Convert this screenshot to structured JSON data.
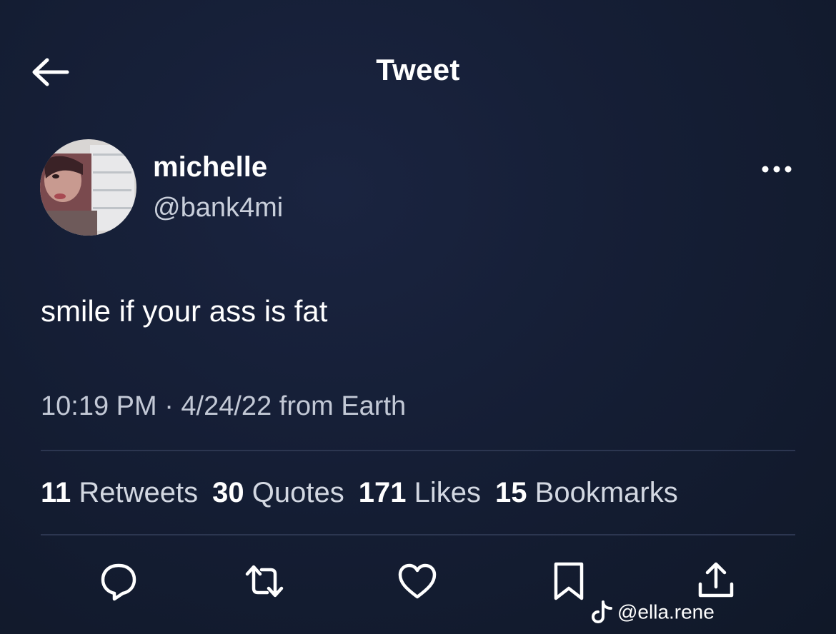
{
  "header": {
    "title": "Tweet",
    "back_icon": "arrow-left-icon"
  },
  "author": {
    "display_name": "michelle",
    "handle": "@bank4mi",
    "avatar": "profile-photo"
  },
  "more_icon": "more-horizontal-icon",
  "tweet": {
    "text": "smile if your ass is fat",
    "meta": "10:19 PM · 4/24/22 from Earth"
  },
  "stats": [
    {
      "count": "11",
      "label": "Retweets"
    },
    {
      "count": "30",
      "label": "Quotes"
    },
    {
      "count": "171",
      "label": "Likes"
    },
    {
      "count": "15",
      "label": "Bookmarks"
    }
  ],
  "actions": [
    "reply-icon",
    "retweet-icon",
    "like-icon",
    "bookmark-icon",
    "share-icon"
  ],
  "watermark": {
    "icon": "tiktok-logo-icon",
    "text": "@ella.rene"
  },
  "colors": {
    "background": "#141d33",
    "text": "#ffffff",
    "muted": "#c3c9d6",
    "divider": "#2c3650"
  }
}
